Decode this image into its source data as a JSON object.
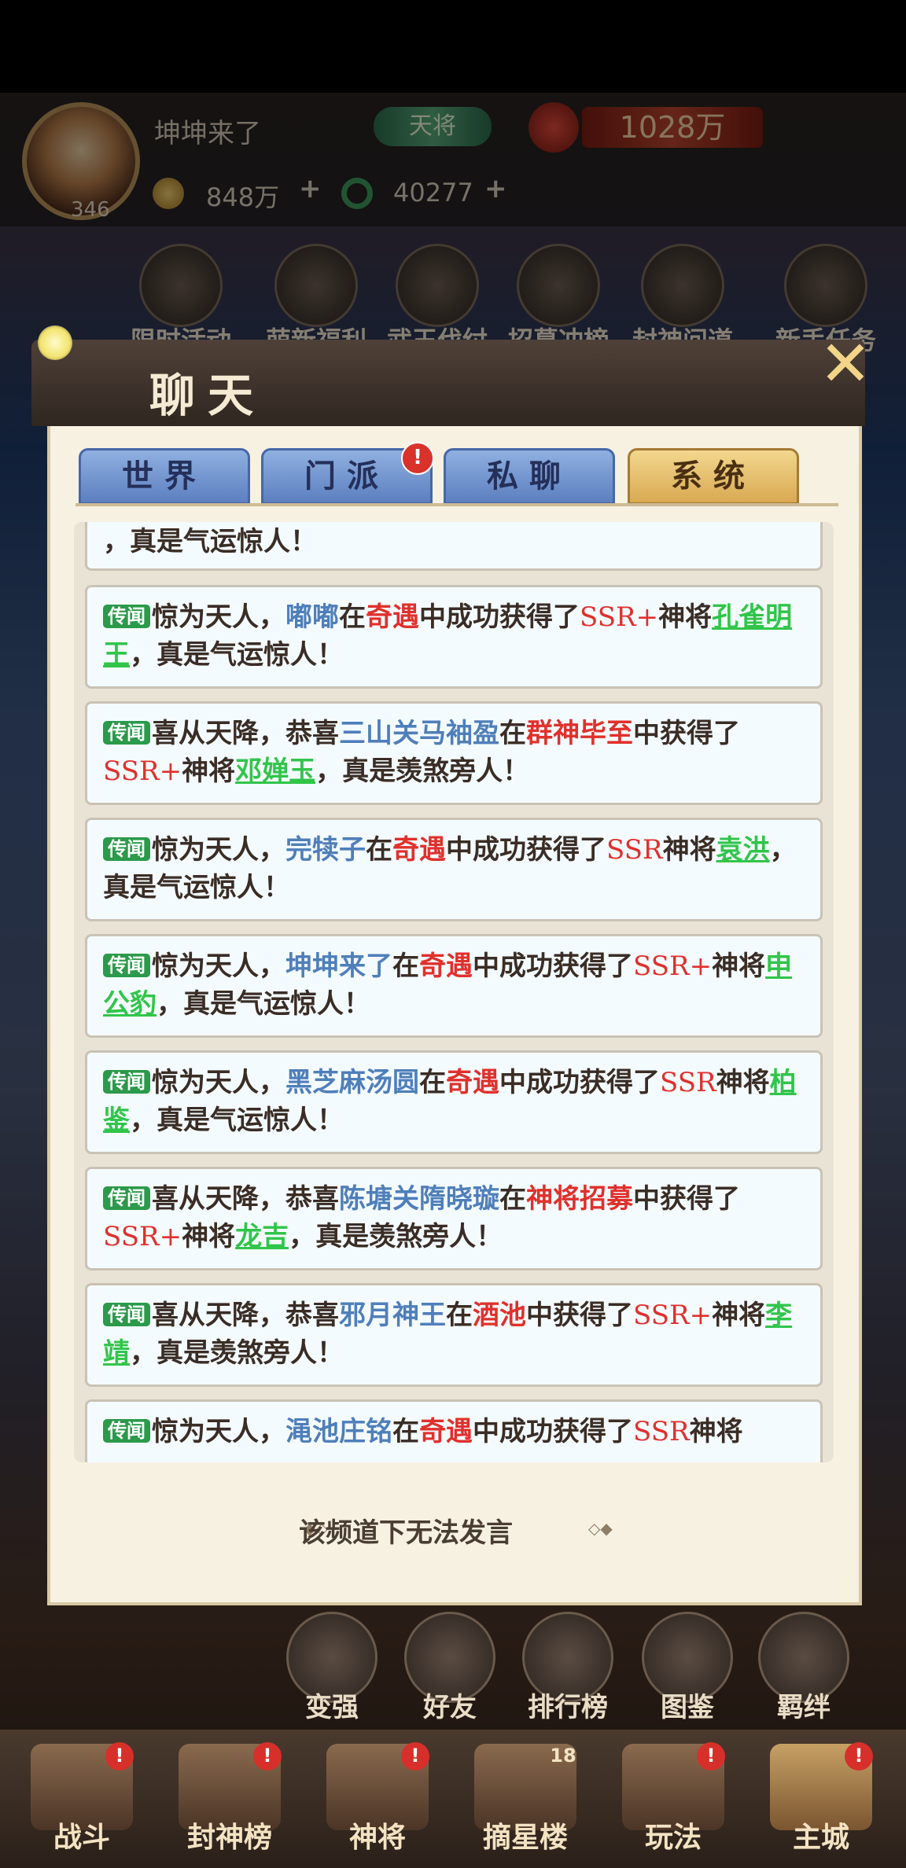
{
  "player": {
    "name": "坤坤来了",
    "level": "346",
    "rank": "天将",
    "power": "1028万",
    "coins": "848万",
    "jade": "40277",
    "plus": "+"
  },
  "activities": [
    {
      "label": "限时活动"
    },
    {
      "label": "萌新福利"
    },
    {
      "label": "武王伐纣"
    },
    {
      "label": "招募冲榜"
    },
    {
      "label": "封神问道"
    },
    {
      "label": "新手任务"
    }
  ],
  "chat": {
    "title": "聊天",
    "close": "✕",
    "tabs": [
      {
        "label": "世界"
      },
      {
        "label": "门派"
      },
      {
        "label": "私聊"
      },
      {
        "label": "系统"
      }
    ],
    "tab_badge": "!",
    "tag": "传闻",
    "top_fragment": "，真是气运惊人！",
    "no_speak": "该频道下无法发言",
    "messages": [
      {
        "lead": "惊为天人，",
        "name": "嘟嘟",
        "mid": "在",
        "event": "奇遇",
        "mid2": "中成功获得了",
        "ssr": "SSR+",
        "mid3": "神将",
        "general": "孔雀明王",
        "end": "，真是气运惊人！"
      },
      {
        "lead": "喜从天降，恭喜",
        "name": "三山关马袖盈",
        "mid": "在",
        "event": "群神毕至",
        "mid2": "中获得了",
        "ssr": "SSR+",
        "mid3": "神将",
        "general": "邓婵玉",
        "end": "，真是羡煞旁人！"
      },
      {
        "lead": "惊为天人，",
        "name": "完犊子",
        "mid": "在",
        "event": "奇遇",
        "mid2": "中成功获得了",
        "ssr": "SSR",
        "mid3": "神将",
        "general": "袁洪",
        "end": "，真是气运惊人！"
      },
      {
        "lead": "惊为天人，",
        "name": "坤坤来了",
        "mid": "在",
        "event": "奇遇",
        "mid2": "中成功获得了",
        "ssr": "SSR+",
        "mid3": "神将",
        "general": "申公豹",
        "end": "，真是气运惊人！"
      },
      {
        "lead": "惊为天人，",
        "name": "黑芝麻汤圆",
        "mid": "在",
        "event": "奇遇",
        "mid2": "中成功获得了",
        "ssr": "SSR",
        "mid3": "神将",
        "general": "柏鉴",
        "end": "，真是气运惊人！"
      },
      {
        "lead": "喜从天降，恭喜",
        "name": "陈塘关隋晓璇",
        "mid": "在",
        "event": "神将招募",
        "mid2": "中获得了",
        "ssr": "SSR+",
        "mid3": "神将",
        "general": "龙吉",
        "end": "，真是羡煞旁人！"
      },
      {
        "lead": "喜从天降，恭喜",
        "name": "邪月神王",
        "mid": "在",
        "event": "酒池",
        "mid2": "中获得了",
        "ssr": "SSR+",
        "mid3": "神将",
        "general": "李靖",
        "end": "，真是羡煞旁人！"
      },
      {
        "lead": "惊为天人，",
        "name": "渑池庄铭",
        "mid": "在",
        "event": "奇遇",
        "mid2": "中成功获得了",
        "ssr": "SSR",
        "mid3": "神将",
        "general": "",
        "end": ""
      }
    ]
  },
  "bottom_buttons": [
    {
      "label": "变强"
    },
    {
      "label": "好友"
    },
    {
      "label": "排行榜"
    },
    {
      "label": "图鉴"
    },
    {
      "label": "羁绊"
    }
  ],
  "nav": [
    {
      "label": "战斗"
    },
    {
      "label": "封神榜"
    },
    {
      "label": "神将"
    },
    {
      "label": "摘星楼",
      "badge": "18"
    },
    {
      "label": "玩法"
    },
    {
      "label": "主城"
    }
  ],
  "badge": "!"
}
